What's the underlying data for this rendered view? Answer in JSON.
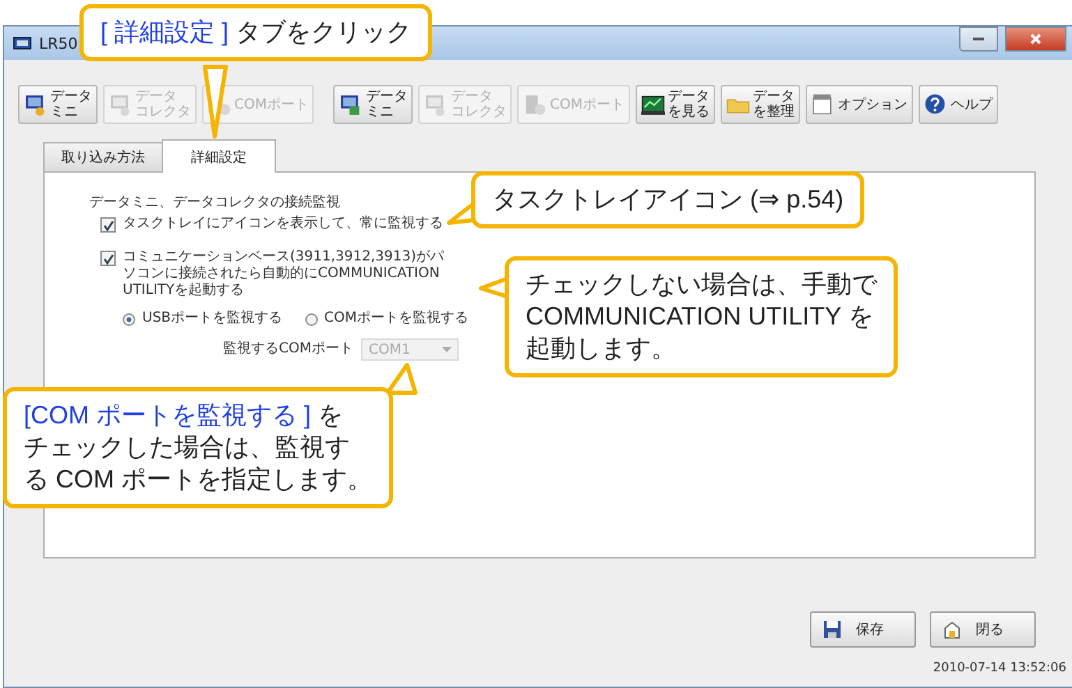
{
  "window": {
    "title": "LR50"
  },
  "toolbar": [
    {
      "lines": [
        "データ",
        "ミニ"
      ],
      "disabled": false
    },
    {
      "lines": [
        "データ",
        "コレクタ"
      ],
      "disabled": true
    },
    {
      "lines": [
        "COMポート"
      ],
      "disabled": true
    },
    {
      "lines": [
        "データ",
        "ミニ"
      ],
      "disabled": false
    },
    {
      "lines": [
        "データ",
        "コレクタ"
      ],
      "disabled": true
    },
    {
      "lines": [
        "COMポート"
      ],
      "disabled": true
    },
    {
      "lines": [
        "データ",
        "を見る"
      ],
      "disabled": false
    },
    {
      "lines": [
        "データ",
        "を整理"
      ],
      "disabled": false
    },
    {
      "lines": [
        "オプション"
      ],
      "disabled": false
    },
    {
      "lines": [
        "ヘルプ"
      ],
      "disabled": false
    }
  ],
  "tabs": [
    {
      "label": "取り込み方法",
      "selected": false
    },
    {
      "label": "詳細設定",
      "selected": true
    }
  ],
  "panel": {
    "group_title": "データミニ、データコレクタの接続監視",
    "checkboxes": [
      {
        "label": "タスクトレイにアイコンを表示して、常に監視する",
        "checked": true
      },
      {
        "label": "コミュニケーションベース(3911,3912,3913)がパソコンに接続されたら自動的にCOMMUNICATION UTILITYを起動する",
        "checked": true
      }
    ],
    "radios": [
      {
        "label": "USBポートを監視する",
        "selected": true
      },
      {
        "label": "COMポートを監視する",
        "selected": false
      }
    ],
    "com_port": {
      "label": "監視するCOMポート",
      "value": "COM1",
      "disabled": true
    }
  },
  "buttons": [
    "保存",
    "閉る"
  ],
  "status_bar": "2010-07-14 13:52:06",
  "callouts": [
    {
      "highlight": "[ 詳細設定 ]",
      "lines": [
        " タブをクリック"
      ]
    },
    {
      "lines": [
        "タスクトレイアイコン (⇒ p.54)"
      ]
    },
    {
      "lines": [
        "チェックしない場合は、手動で",
        "COMMUNICATION UTILITY を",
        "起動します。"
      ]
    },
    {
      "highlight": "[COM ポートを監視する ]",
      "lines": [
        " を",
        "チェックした場合は、監視す",
        "る COM ポートを指定します。"
      ]
    }
  ]
}
